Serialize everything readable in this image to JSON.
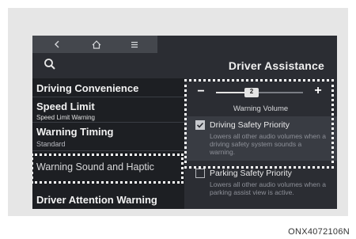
{
  "topbar": {
    "back_icon": "chevron-left-icon",
    "home_icon": "home-icon",
    "menu_icon": "menu-icon"
  },
  "header": {
    "search_icon": "search-icon",
    "title": "Driver Assistance"
  },
  "menu": {
    "items": [
      {
        "label": "Driving Convenience",
        "sub": ""
      },
      {
        "label": "Speed Limit",
        "sub": "Speed Limit Warning"
      },
      {
        "label": "Warning Timing",
        "sub": "Standard"
      },
      {
        "label": "Warning Sound and Haptic",
        "sub": ""
      },
      {
        "label": "Driver Attention Warning",
        "sub": ""
      }
    ]
  },
  "volume": {
    "minus": "−",
    "plus": "+",
    "value": "2",
    "label": "Warning Volume",
    "level_fraction": 0.4
  },
  "options": [
    {
      "title": "Driving Safety Priority",
      "checked": true,
      "desc": "Lowers all other audio volumes when a driving safety system sounds a warning."
    },
    {
      "title": "Parking Safety Priority",
      "checked": false,
      "desc": "Lowers all other audio volumes when a parking assist view is active."
    }
  ],
  "figure_code": "ONX4072106N",
  "colors": {
    "screen_bg": "#2b2d33",
    "list_bg": "#1d1f23",
    "highlight": "#ffffff",
    "check_accent": "#c8cacf"
  }
}
